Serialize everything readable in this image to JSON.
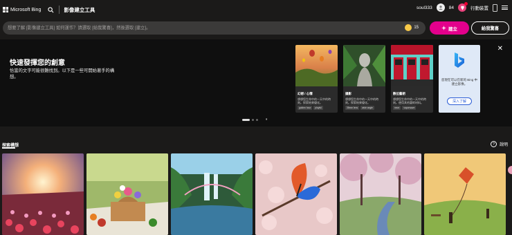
{
  "header": {
    "brand": "Microsoft Bing",
    "app_title": "影像建立工具",
    "username": "soul333",
    "rewards_points": "84",
    "mobile_label": "行動裝置"
  },
  "prompt": {
    "placeholder": "想要了解 [影像建立工具] 如何運作？請選取 [給我驚喜]，然後選取 [建立]。",
    "boost_count": "15",
    "create_label": "建立",
    "surprise_label": "給我驚喜"
  },
  "hero": {
    "title": "快速發揮您的創意",
    "subtitle": "恰當的文字可能很難找到。以下是一些可開始著手的構想。",
    "cards": [
      {
        "title": "幻想 / 心情",
        "desc": "想想您生命中的一天中的時刻。探索結果優化。",
        "tags": [
          "golden hour",
          "playful"
        ]
      },
      {
        "title": "攝影",
        "desc": "想想您生命中的一天中的時刻。探索結果優化。",
        "tags": [
          "35mm lens",
          "wide angle"
        ]
      },
      {
        "title": "數位藝術",
        "desc": "想想您生命中的一天中的時刻。使用其他藝術材料。",
        "tags": [
          "neon",
          "vaporwave"
        ]
      }
    ],
    "promo": {
      "text": "您現在可以在新的 Bing 中建立影像。",
      "button": "深入了解"
    }
  },
  "explore": {
    "label": "探索構想",
    "help": "說明"
  },
  "colors": {
    "accent": "#e3008c",
    "background": "#1b1a19"
  }
}
